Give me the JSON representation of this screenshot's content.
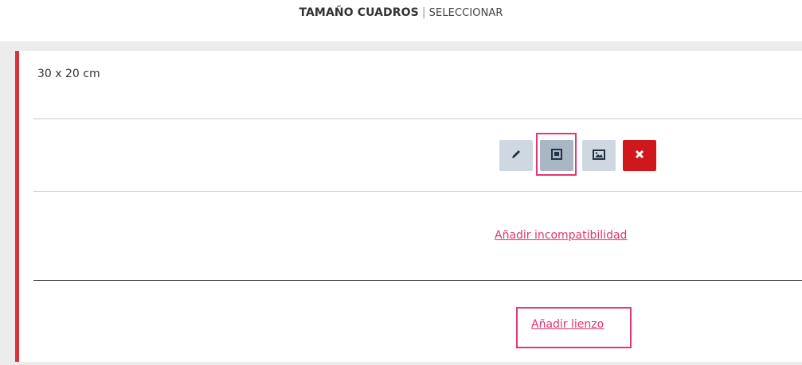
{
  "header": {
    "title_bold": "TAMAÑO CUADROS",
    "separator": "|",
    "subtitle": "SELECCIONAR"
  },
  "card": {
    "size_label": "30 x 20 cm",
    "accent_color": "#d9343a",
    "actions": [
      {
        "name": "edit",
        "icon": "pencil-icon"
      },
      {
        "name": "frame",
        "icon": "framed-image-icon",
        "selected": true
      },
      {
        "name": "image",
        "icon": "image-icon"
      },
      {
        "name": "delete",
        "icon": "close-icon",
        "color": "#d0171b"
      }
    ],
    "add_incompatibility_label": "Añadir incompatibilidad",
    "add_canvas_label": "Añadir lienzo"
  },
  "colors": {
    "link": "#e2336f",
    "highlight": "#e0387a"
  }
}
